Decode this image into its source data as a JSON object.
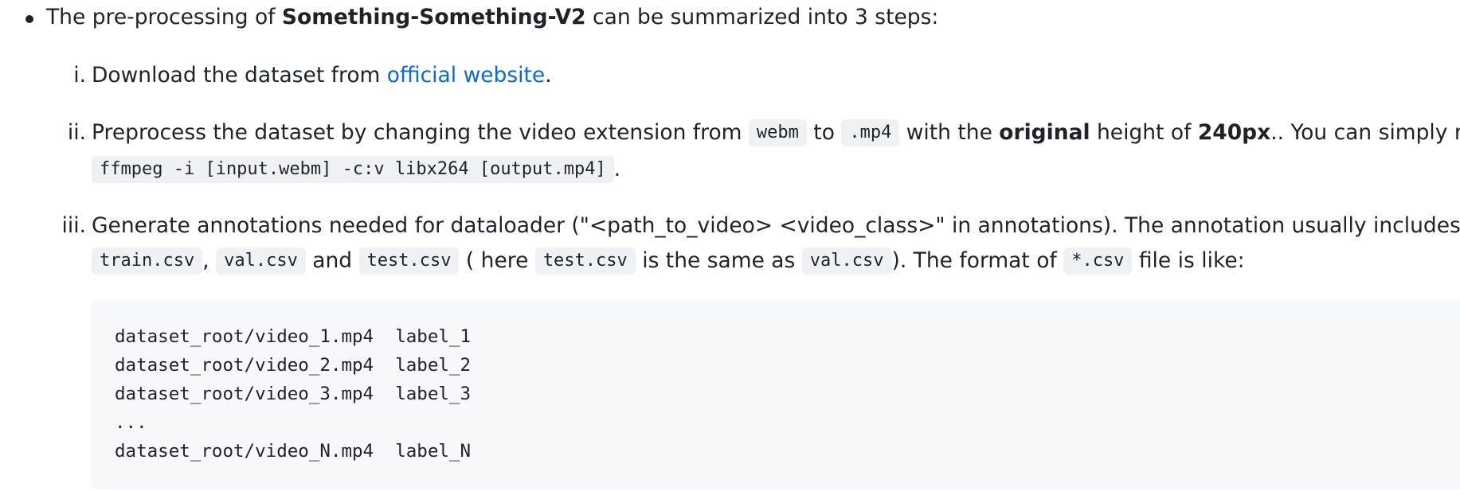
{
  "intro": {
    "pre": "The pre-processing of ",
    "dataset_name": "Something-Something-V2",
    "post": " can be summarized into 3 steps:"
  },
  "steps": [
    {
      "marker": "i.",
      "text_pre": "Download the dataset from ",
      "link": "official website",
      "text_post": "."
    },
    {
      "marker": "ii.",
      "seg1": "Preprocess the dataset by changing the video extension from ",
      "code1": "webm",
      "seg2": " to ",
      "code2": ".mp4",
      "seg3": " with the ",
      "bold1": "original",
      "seg4": " height of ",
      "bold2": "240px",
      "seg5": ".. You can simply run",
      "command": "ffmpeg -i [input.webm] -c:v libx264 [output.mp4]",
      "seg6": "."
    },
    {
      "marker": "iii.",
      "line1": "Generate annotations needed for dataloader (\"<path_to_video> <video_class>\" in annotations). The annotation usually includes",
      "code_train": "train.csv",
      "sep1": ",",
      "code_val": "val.csv",
      "sep2": " and ",
      "code_test": "test.csv",
      "sep3": " ( here ",
      "code_test2": "test.csv",
      "sep4": " is the same as ",
      "code_val2": "val.csv",
      "sep5": "). The format of ",
      "code_glob": "*.csv",
      "sep6": " file is like:"
    }
  ],
  "code_block": {
    "lines": [
      "dataset_root/video_1.mp4  label_1",
      "dataset_root/video_2.mp4  label_2",
      "dataset_root/video_3.mp4  label_3",
      "...",
      "dataset_root/video_N.mp4  label_N"
    ]
  }
}
